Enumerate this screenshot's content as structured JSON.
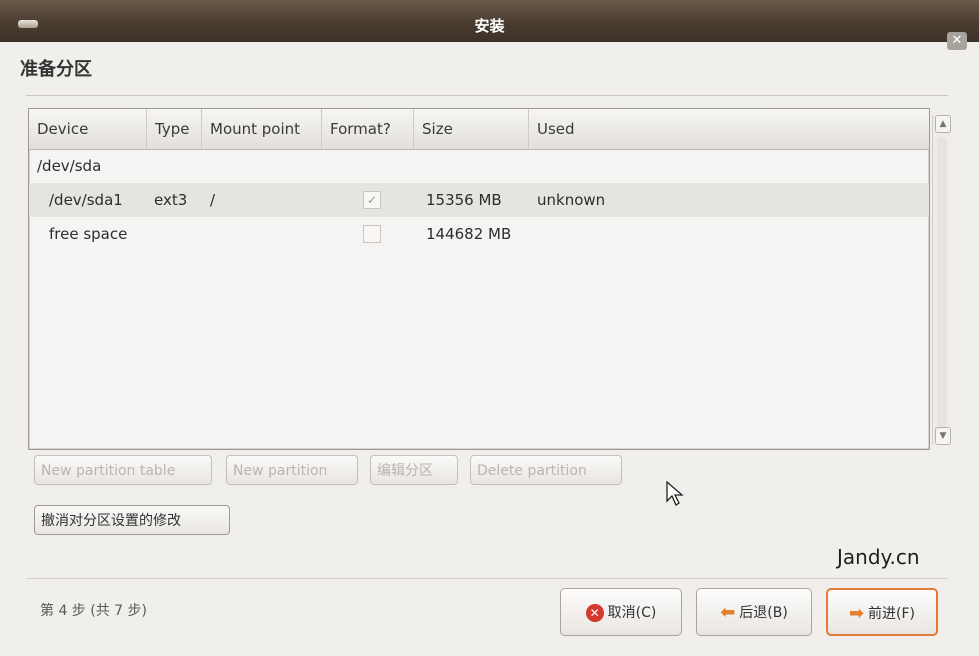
{
  "window": {
    "title": "安装",
    "close_label": "✕"
  },
  "page": {
    "heading": "准备分区"
  },
  "table": {
    "columns": [
      "Device",
      "Type",
      "Mount point",
      "Format?",
      "Size",
      "Used"
    ],
    "rows": [
      {
        "device": "/dev/sda",
        "type": "",
        "mount": "",
        "format": null,
        "size": "",
        "used": ""
      },
      {
        "device": "/dev/sda1",
        "type": "ext3",
        "mount": "/",
        "format": true,
        "size": "15356 MB",
        "used": "unknown"
      },
      {
        "device": "free space",
        "type": "",
        "mount": "",
        "format": false,
        "size": "144682 MB",
        "used": ""
      }
    ]
  },
  "partition_buttons": {
    "new_table": "New partition table",
    "new_partition": "New partition",
    "edit": "编辑分区",
    "delete": "Delete partition",
    "undo": "撤消对分区设置的修改"
  },
  "watermark": "Jandy.cn",
  "footer": {
    "step": "第 4 步 (共 7 步)",
    "cancel": "取消(C)",
    "back": "后退(B)",
    "forward": "前进(F)"
  },
  "icons": [
    "menu-icon",
    "close-icon",
    "check-icon",
    "cancel-icon",
    "back-arrow-icon",
    "forward-arrow-icon",
    "mouse-cursor-icon"
  ],
  "colors": {
    "titlebar": "#4a3c30",
    "accent": "#e07b3a",
    "cancel_icon": "#d33a2f"
  }
}
